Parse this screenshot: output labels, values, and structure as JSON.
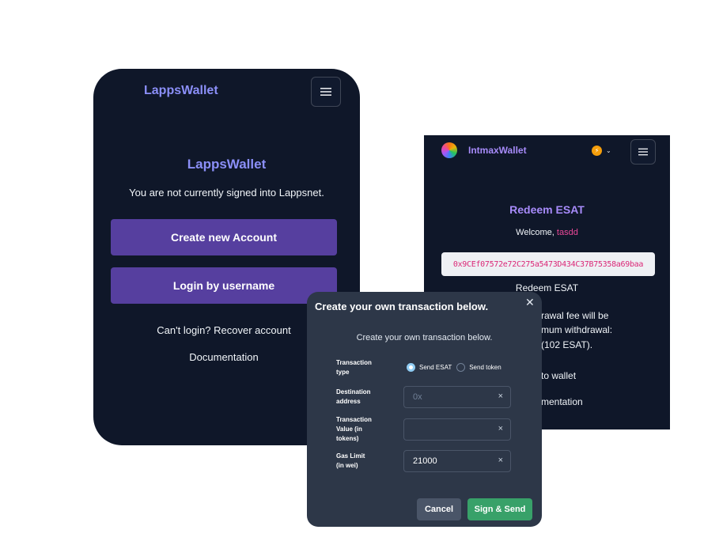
{
  "lapps": {
    "brand": "LappsWallet",
    "menu_icon": "hamburger-icon",
    "title": "LappsWallet",
    "subtitle": "You are not currently signed into Lappsnet.",
    "create_button": "Create new Account",
    "login_button": "Login by username",
    "recover_link": "Can't login? Recover account",
    "docs_link": "Documentation",
    "button_color": "#563f9f",
    "brand_color": "#8b8ff8"
  },
  "intmax": {
    "brand": "IntmaxWallet",
    "network_icon": "lightning-icon",
    "menu_icon": "hamburger-icon",
    "title": "Redeem ESAT",
    "welcome_prefix": "Welcome, ",
    "username": "tasdd",
    "address": "0x9CEf07572e72C275a5473D434C37B75358a69baa",
    "redeem_label": "Redeem ESAT",
    "line1": "rawal fee will be",
    "line2": "mum withdrawal:",
    "line3": "(102 ESAT).",
    "line4": "to wallet",
    "line5": "mentation"
  },
  "modal": {
    "title": "Create your own transaction below.",
    "subtitle": "Create your own transaction below.",
    "close_icon": "close-icon",
    "label_type_1": "Transaction",
    "label_type_2": "type",
    "option_send_esat": "Send ESAT",
    "option_send_token": "Send token",
    "selected_option": "Send ESAT",
    "label_dest_1": "Destination",
    "label_dest_2": "address",
    "dest_placeholder": "0x",
    "dest_value": "",
    "label_value_1": "Transaction",
    "label_value_2": "Value (in",
    "label_value_3": "tokens)",
    "value_value": "",
    "label_gas_1": "Gas Limit",
    "label_gas_2": "(in wei)",
    "gas_value": "21000",
    "clear_glyph": "×",
    "cancel_button": "Cancel",
    "sign_button": "Sign & Send"
  }
}
